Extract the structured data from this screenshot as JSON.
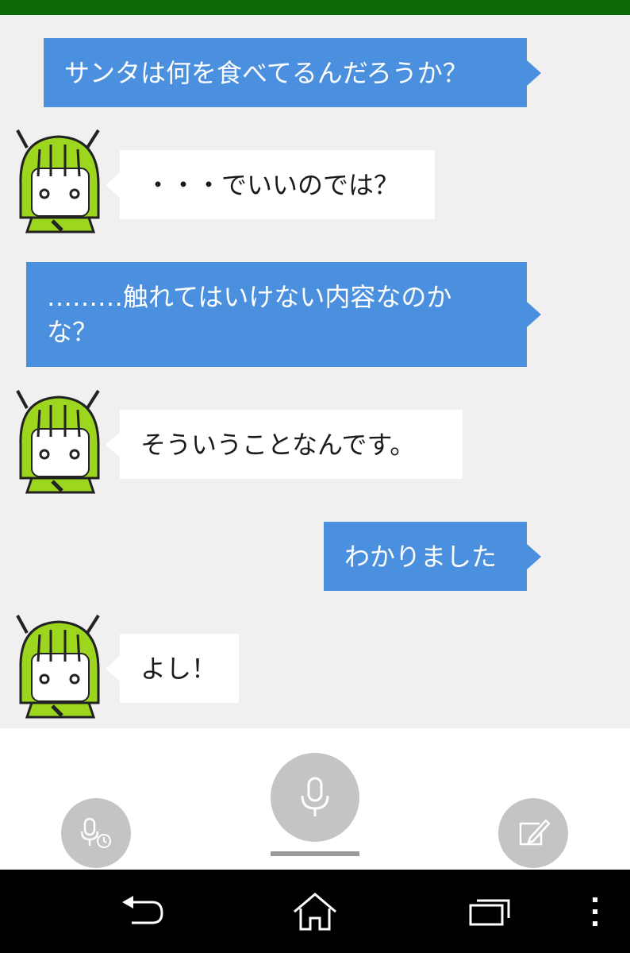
{
  "messages": [
    {
      "from": "user",
      "text": "サンタは何を食べてるんだろうか？"
    },
    {
      "from": "bot",
      "text": "・・・でいいのでは？"
    },
    {
      "from": "user",
      "text": "………触れてはいけない内容なのかな？"
    },
    {
      "from": "bot",
      "text": "そういうことなんです。"
    },
    {
      "from": "user",
      "text": "わかりました"
    },
    {
      "from": "bot",
      "text": "よし！"
    }
  ],
  "icons": {
    "avatar": "green-haired-character-icon",
    "voice_history": "mic-clock-icon",
    "mic": "mic-icon",
    "edit": "edit-icon",
    "back": "back-icon",
    "home": "home-icon",
    "recents": "recents-icon",
    "menu": "overflow-menu-icon"
  },
  "colors": {
    "status_bar": "#0b6a06",
    "user_bubble": "#4a90df",
    "bot_bubble": "#ffffff",
    "chat_background": "#f0f0f0",
    "button_gray": "#c4c4c4",
    "avatar_hair": "#9cd61e"
  }
}
